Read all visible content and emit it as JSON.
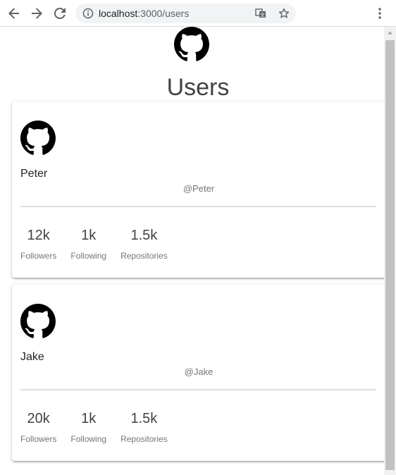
{
  "browser": {
    "url_host": "localhost",
    "url_path": ":3000/users",
    "icons": {
      "back": "arrow-left-icon",
      "forward": "arrow-right-icon",
      "reload": "reload-icon",
      "info": "info-icon",
      "translate": "translate-icon",
      "bookmark": "star-icon",
      "menu": "kebab-menu-icon"
    }
  },
  "page": {
    "logo": "github-icon",
    "title": "Users"
  },
  "users": [
    {
      "name": "Peter",
      "handle": "@Peter",
      "stats": [
        {
          "value": "12k",
          "label": "Followers"
        },
        {
          "value": "1k",
          "label": "Following"
        },
        {
          "value": "1.5k",
          "label": "Repositories"
        }
      ]
    },
    {
      "name": "Jake",
      "handle": "@Jake",
      "stats": [
        {
          "value": "20k",
          "label": "Followers"
        },
        {
          "value": "1k",
          "label": "Following"
        },
        {
          "value": "1.5k",
          "label": "Repositories"
        }
      ]
    }
  ],
  "colors": {
    "chrome_bg": "#ffffff",
    "omnibox_bg": "#f1f3f4",
    "text_primary": "#212121",
    "text_secondary": "#757575",
    "divider": "#e0e0e0"
  }
}
